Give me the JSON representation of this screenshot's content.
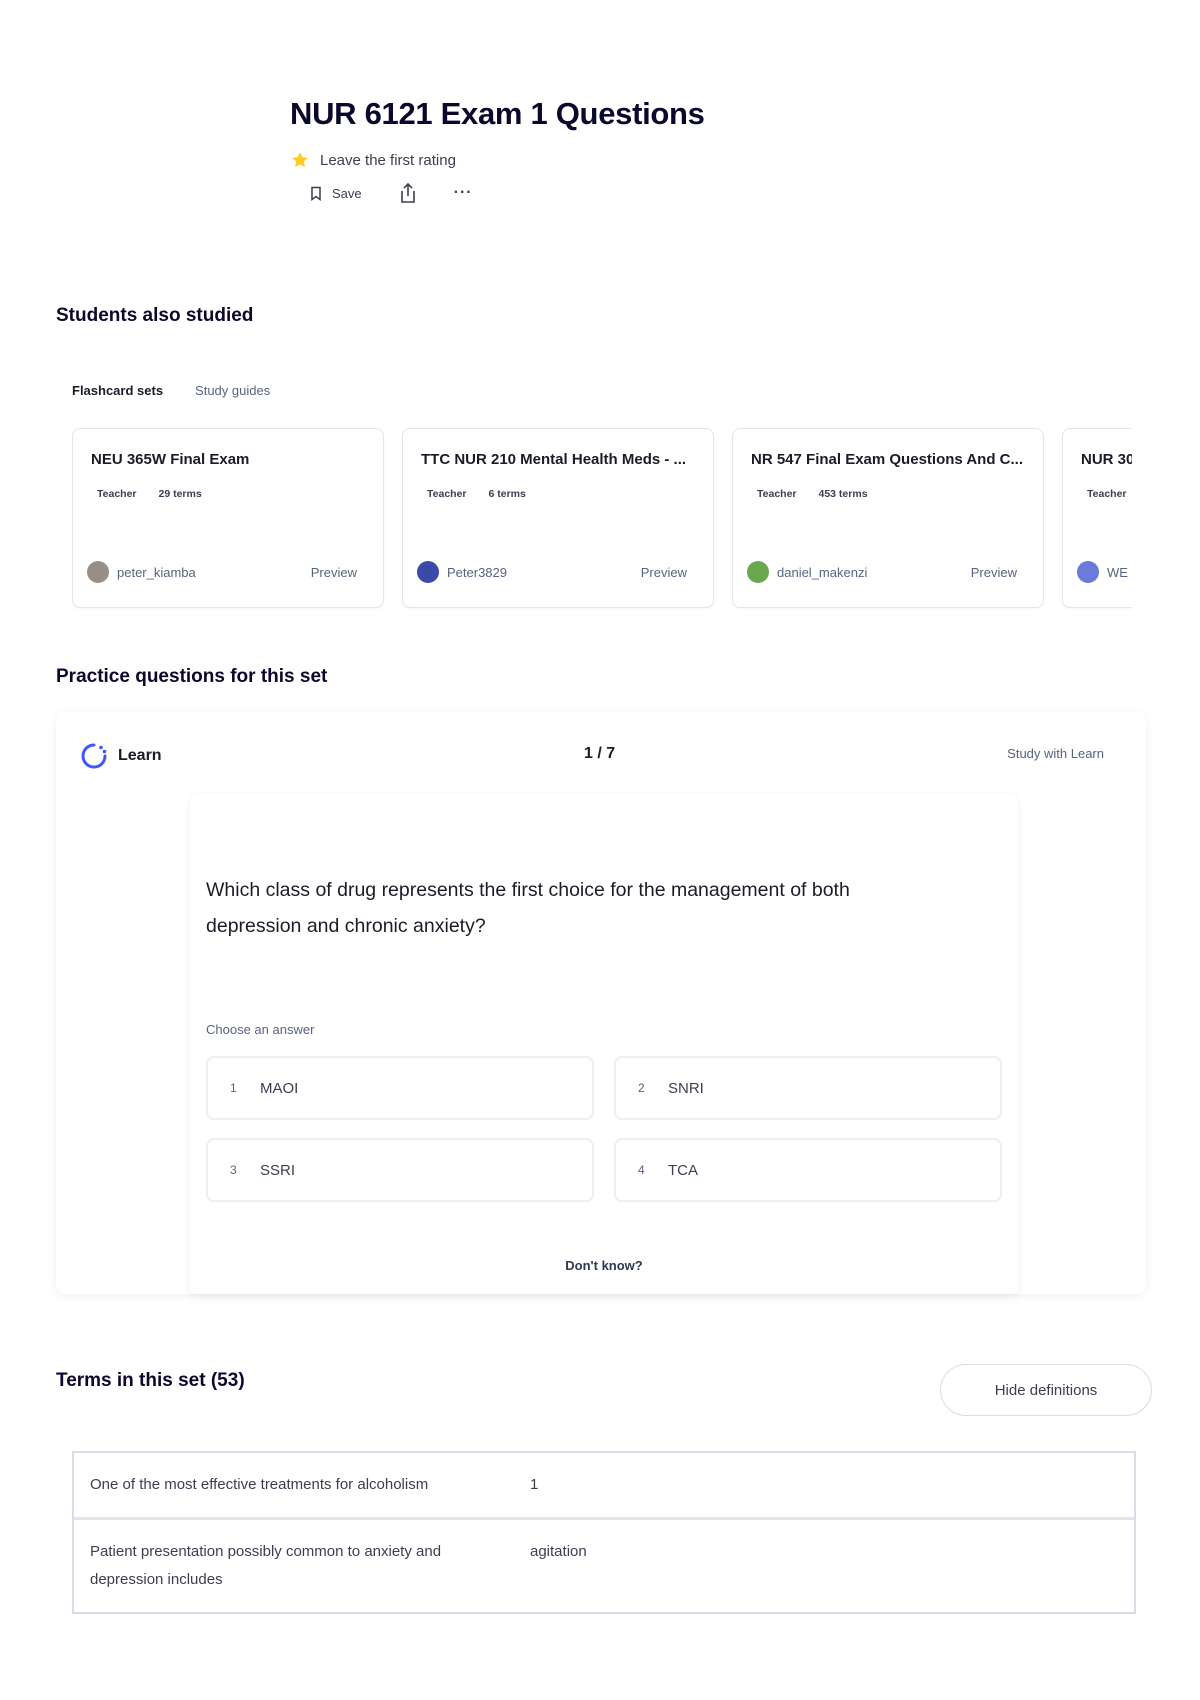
{
  "header": {
    "title": "NUR 6121 Exam 1 Questions",
    "rating_text": "Leave the first rating",
    "save_label": "Save",
    "more_label": "···"
  },
  "students_also_studied": {
    "heading": "Students also studied",
    "tabs": [
      {
        "label": "Flashcard sets",
        "active": true
      },
      {
        "label": "Study guides",
        "active": false
      }
    ],
    "cards": [
      {
        "title": "NEU 365W Final Exam",
        "role": "Teacher",
        "terms": "29 terms",
        "user": "peter_kiamba",
        "preview": "Preview",
        "avatar_color": "#9a8f86"
      },
      {
        "title": "TTC NUR 210 Mental Health Meds - ...",
        "role": "Teacher",
        "terms": "6 terms",
        "user": "Peter3829",
        "preview": "Preview",
        "avatar_color": "#3b4aa8"
      },
      {
        "title": "NR 547 Final Exam Questions And C...",
        "role": "Teacher",
        "terms": "453 terms",
        "user": "daniel_makenzi",
        "preview": "Preview",
        "avatar_color": "#6aa84f"
      },
      {
        "title": "NUR 30",
        "role": "Teacher",
        "terms": "",
        "user": "WE",
        "preview": "",
        "avatar_color": "#6c7ad9"
      }
    ]
  },
  "practice": {
    "heading": "Practice questions for this set",
    "mode_label": "Learn",
    "progress": "1 / 7",
    "study_link": "Study with Learn",
    "question": "Which class of drug represents the first choice for the management of both depression and chronic anxiety?",
    "choose_label": "Choose an answer",
    "options": [
      {
        "num": "1",
        "label": "MAOI"
      },
      {
        "num": "2",
        "label": "SNRI"
      },
      {
        "num": "3",
        "label": "SSRI"
      },
      {
        "num": "4",
        "label": "TCA"
      }
    ],
    "dont_know": "Don't know?",
    "accent_color": "#4255ff"
  },
  "terms_section": {
    "heading": "Terms in this set (53)",
    "hide_button": "Hide definitions",
    "rows": [
      {
        "term": "One of the most effective treatments for alcoholism",
        "definition": "1"
      },
      {
        "term": "Patient presentation possibly common to anxiety and depression includes",
        "definition": "agitation"
      }
    ]
  },
  "icons": {
    "star": "star-icon",
    "save": "bookmark-icon",
    "share": "share-icon",
    "more": "more-icon",
    "learn": "learn-icon"
  }
}
